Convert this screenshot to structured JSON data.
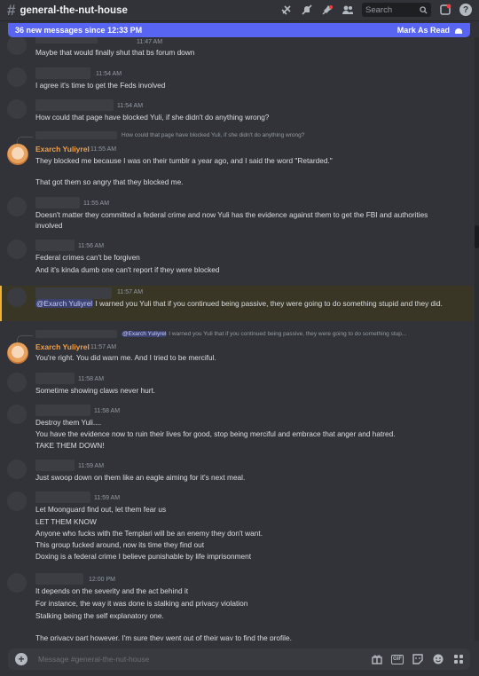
{
  "header": {
    "channel_name": "general-the-nut-house",
    "search_placeholder": "Search",
    "help_label": "?"
  },
  "new_messages": {
    "text": "36 new messages since 12:33 PM",
    "action": "Mark As Read"
  },
  "messages": [
    {
      "timestamp": "11:47 AM",
      "lines": [
        "Maybe that would finally shut that bs forum down"
      ]
    },
    {
      "timestamp": "11:54 AM",
      "lines": [
        "I agree it's time to get the Feds involved"
      ]
    },
    {
      "timestamp": "11:54 AM",
      "lines": [
        "How could that page have blocked Yuli, if she didn't do anything wrong?"
      ]
    },
    {
      "reply_preview": "How could that page have blocked Yuli, if she didn't do anything wrong?",
      "author": "Exarch Yuliyrel",
      "timestamp": "11:55 AM",
      "lines": [
        "They blocked me because I was on their tumblr a year ago, and I said the word \"Retarded.\"",
        "That got them so angry that they blocked me."
      ]
    },
    {
      "timestamp": "11:55 AM",
      "lines": [
        "Doesn't matter they committed a federal crime and now Yuli has the evidence against them to get the FBI and authorities involved"
      ]
    },
    {
      "timestamp": "11:56 AM",
      "lines": [
        "Federal crimes can't be forgiven",
        "And it's kinda dumb one can't report if they were blocked"
      ]
    },
    {
      "timestamp": "11:57 AM",
      "mention": "@Exarch Yuliyrel",
      "lines": [
        " I warned you Yuli that if you continued being passive, they were going to do something stupid and they did."
      ]
    },
    {
      "reply_mention": "@Exarch Yuliyrel",
      "reply_preview": " I warned you Yuli that if you continued being passive, they were going to do something stup...",
      "author": "Exarch Yuliyrel",
      "timestamp": "11:57 AM",
      "lines": [
        "You're right. You did warn me. And I tried to be merciful."
      ]
    },
    {
      "timestamp": "11:58 AM",
      "lines": [
        "Sometime showing claws never hurt."
      ]
    },
    {
      "timestamp": "11:58 AM",
      "lines": [
        "Destroy them Yuli....",
        "You have the evidence now to ruin their lives for good, stop being merciful and embrace that anger and hatred.",
        "TAKE THEM DOWN!"
      ]
    },
    {
      "timestamp": "11:59 AM",
      "lines": [
        "Just swoop down on them like an eagle aiming for it's next meal."
      ]
    },
    {
      "timestamp": "11:59 AM",
      "lines": [
        "Let Moonguard find out, let them fear us",
        "LET THEM KNOW",
        "Anyone who fucks with the Templari will be an enemy they don't want.",
        "This group fucked around, now its time they find out",
        "Doxing is a federal crime I believe punishable by life imprisonment"
      ]
    },
    {
      "timestamp": "12:00 PM",
      "lines": [
        "It depends on the severity and the act behind it",
        "For instance, the way it was done is stalking and privacy violation",
        "Stalking being the self explanatory one.",
        "The privacy part however, I'm sure they went out of their way to find the profile."
      ]
    }
  ],
  "composer": {
    "placeholder": "Message #general-the-nut-house",
    "gif_label": "GIF"
  },
  "colors": {
    "accent": "#5865f2",
    "author": "#f0a04b",
    "highlight": "#f0b232"
  }
}
